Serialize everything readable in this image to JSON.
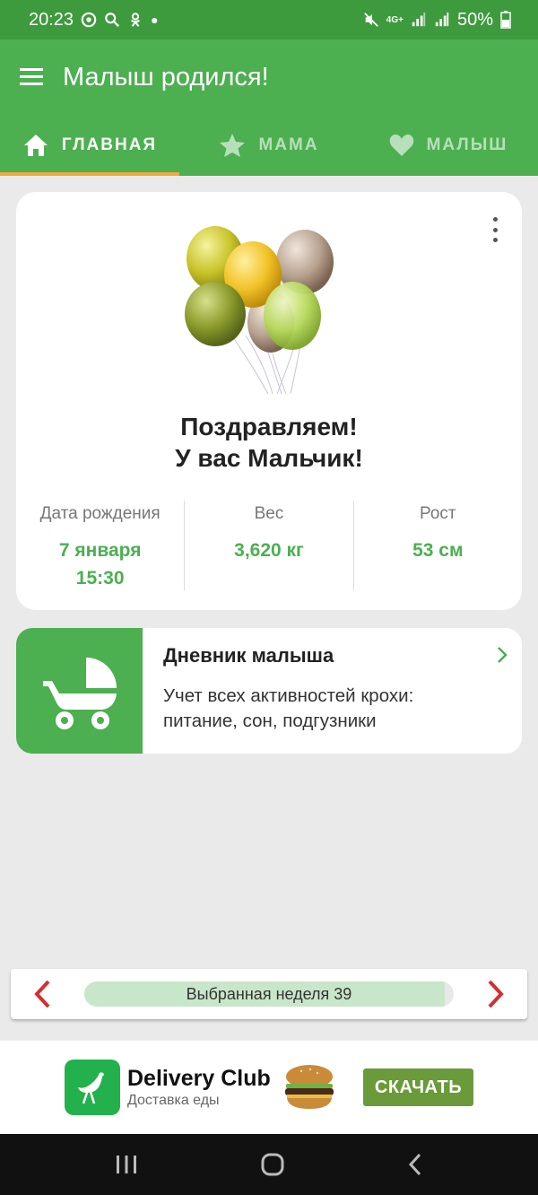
{
  "status": {
    "time": "20:23",
    "network": "4G+",
    "battery": "50%"
  },
  "appbar": {
    "title": "Малыш родился!"
  },
  "tabs": [
    {
      "label": "ГЛАВНАЯ",
      "icon": "home-icon"
    },
    {
      "label": "МАМА",
      "icon": "star-icon"
    },
    {
      "label": "МАЛЫШ",
      "icon": "heart-icon"
    }
  ],
  "birth_card": {
    "congrats_line1": "Поздравляем!",
    "congrats_line2": "У вас Мальчик!",
    "stats": [
      {
        "label": "Дата рождения",
        "value_line1": "7 января",
        "value_line2": "15:30"
      },
      {
        "label": "Вес",
        "value_line1": "3,620 кг",
        "value_line2": ""
      },
      {
        "label": "Рост",
        "value_line1": "53 см",
        "value_line2": ""
      }
    ]
  },
  "diary": {
    "title": "Дневник малыша",
    "description": "Учет всех активностей крохи: питание, сон, подгузники"
  },
  "week": {
    "label": "Выбранная неделя 39",
    "progress": 0.975
  },
  "ad": {
    "brand": "Delivery Club",
    "subtitle": "Доставка еды",
    "cta": "СКАЧАТЬ"
  },
  "colors": {
    "primary": "#4caf50",
    "status_bar": "#3d9a3d",
    "tab_indicator": "#f2a93b",
    "arrow": "#d32f2f"
  }
}
